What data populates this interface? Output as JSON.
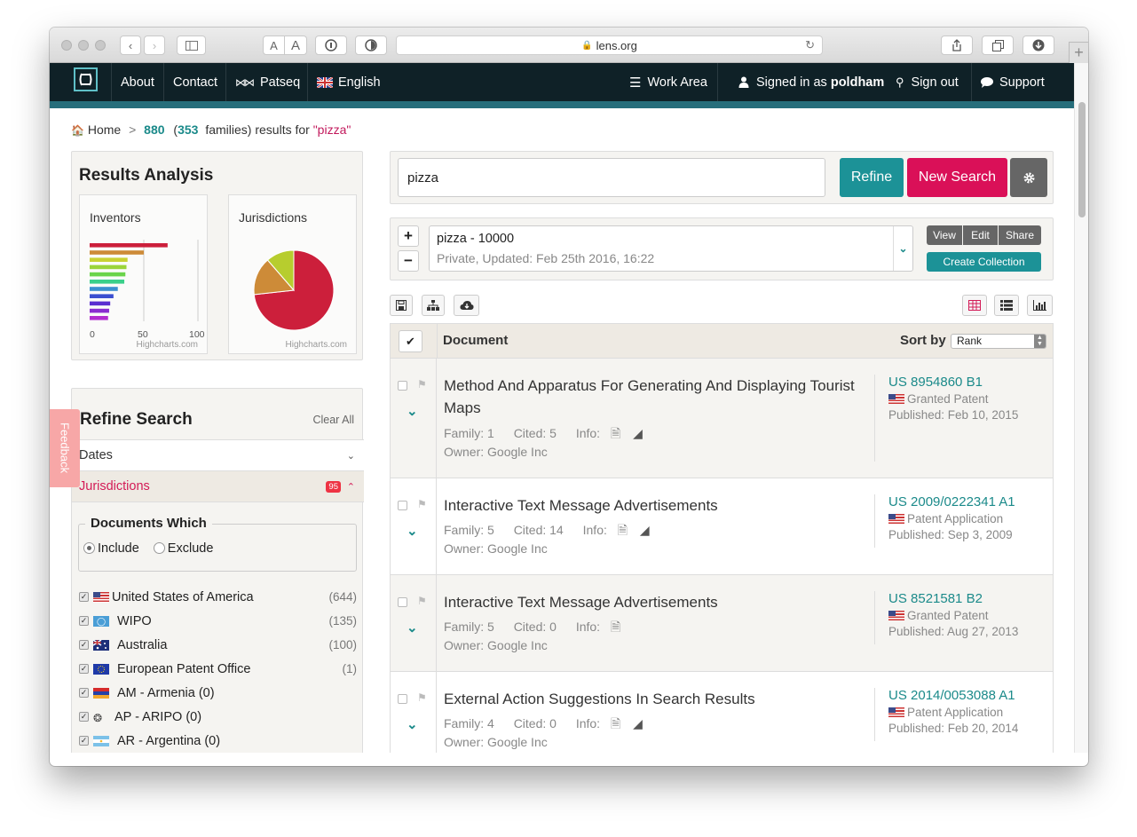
{
  "browser": {
    "url": "lens.org",
    "font_small": "A",
    "font_large": "A"
  },
  "nav": {
    "about": "About",
    "contact": "Contact",
    "patseq": "Patseq",
    "english": "English",
    "work_area": "Work Area",
    "signed_prefix": "Signed in as",
    "username": "poldham",
    "sign_out": "Sign out",
    "support": "Support"
  },
  "breadcrumb": {
    "home": "Home",
    "sep": ">",
    "count": "880",
    "open": "(",
    "families": "353",
    "suffix": "families) results for",
    "query": "\"pizza\""
  },
  "analysis": {
    "title": "Results Analysis",
    "inventors_label": "Inventors",
    "jurisdictions_label": "Jurisdictions",
    "credit": "Highcharts.com",
    "axis_ticks": [
      "0",
      "50",
      "100"
    ]
  },
  "chart_data": [
    {
      "type": "bar",
      "title": "Inventors",
      "orientation": "horizontal",
      "xlim": [
        0,
        100
      ],
      "values": [
        72,
        50,
        35,
        34,
        33,
        32,
        26,
        22,
        19,
        18,
        17
      ],
      "colors": [
        "#cc1f3b",
        "#cd8b38",
        "#c9d233",
        "#9bd43a",
        "#6ad44a",
        "#3ad08a",
        "#3b8fd0",
        "#3b4fd0",
        "#5a2ed0",
        "#8a2ed0",
        "#b32ed0"
      ]
    },
    {
      "type": "pie",
      "title": "Jurisdictions",
      "values": [
        644,
        135,
        100
      ],
      "colors": [
        "#cc1f3b",
        "#cd8b38",
        "#b7cd2e"
      ]
    }
  ],
  "refine": {
    "title": "Refine Search",
    "clear_all": "Clear All",
    "dates_label": "Dates",
    "jurisdictions_label": "Jurisdictions",
    "jurisdictions_badge": "95",
    "documents_which": "Documents Which",
    "include": "Include",
    "exclude": "Exclude",
    "items": [
      {
        "label": "United States of America",
        "count": "(644)"
      },
      {
        "label": "WIPO",
        "count": "(135)"
      },
      {
        "label": "Australia",
        "count": "(100)"
      },
      {
        "label": "European Patent Office",
        "count": "(1)"
      },
      {
        "label": "AM - Armenia (0)",
        "count": ""
      },
      {
        "label": "AP - ARIPO (0)",
        "count": ""
      },
      {
        "label": "AR - Argentina (0)",
        "count": ""
      }
    ]
  },
  "feedback": "Feedback",
  "search": {
    "value": "pizza",
    "refine_btn": "Refine",
    "new_search_btn": "New Search"
  },
  "collection": {
    "name": "pizza - 10000",
    "info": "Private, Updated: Feb 25th 2016, 16:22",
    "view": "View",
    "edit": "Edit",
    "share": "Share",
    "create": "Create Collection"
  },
  "table": {
    "document_header": "Document",
    "sort_by": "Sort by",
    "sort_value": "Rank"
  },
  "results": [
    {
      "title": "Method And Apparatus For Generating And Displaying Tourist Maps",
      "family": "Family: 1",
      "cited": "Cited: 5",
      "info": "Info:",
      "owner": "Owner: Google Inc",
      "number": "US 8954860 B1",
      "type": "Granted Patent",
      "published": "Published: Feb 10, 2015"
    },
    {
      "title": "Interactive Text Message Advertisements",
      "family": "Family: 5",
      "cited": "Cited: 14",
      "info": "Info:",
      "owner": "Owner: Google Inc",
      "number": "US 2009/0222341 A1",
      "type": "Patent Application",
      "published": "Published: Sep 3, 2009"
    },
    {
      "title": "Interactive Text Message Advertisements",
      "family": "Family: 5",
      "cited": "Cited: 0",
      "info": "Info:",
      "owner": "Owner: Google Inc",
      "number": "US 8521581 B2",
      "type": "Granted Patent",
      "published": "Published: Aug 27, 2013"
    },
    {
      "title": "External Action Suggestions In Search Results",
      "family": "Family: 4",
      "cited": "Cited: 0",
      "info": "Info:",
      "owner": "Owner: Google Inc",
      "number": "US 2014/0053088 A1",
      "type": "Patent Application",
      "published": "Published: Feb 20, 2014"
    }
  ]
}
